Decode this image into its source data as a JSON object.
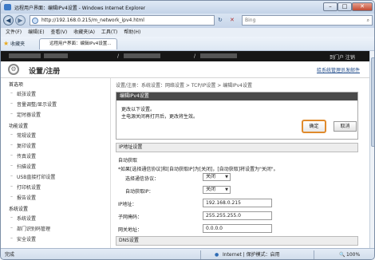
{
  "window": {
    "title": "远程用户界面：编辑IPv4设置 - Windows Internet Explorer"
  },
  "address": {
    "url": "http://192.168.0.215/m_network_ipv4.html",
    "search_placeholder": "Bing",
    "refresh": "↻",
    "stop": "✕"
  },
  "menu": [
    "文件(F)",
    "编辑(E)",
    "查看(V)",
    "收藏夹(A)",
    "工具(T)",
    "帮助(H)"
  ],
  "favorites": {
    "label": "收藏夹",
    "tab": "远程用户界面：编辑IPv4设置..."
  },
  "topbar": {
    "left": "/",
    "right": "到门户  注销"
  },
  "header": {
    "title": "设置/注册",
    "link": "给系统管理员发邮件"
  },
  "sidebar": {
    "groups": [
      {
        "label": "首选项",
        "items": [
          "纸张设置",
          "音量调整/显示设置",
          "定时器设置"
        ]
      },
      {
        "label": "功能设置",
        "items": [
          "常规设置",
          "复印设置",
          "传真设置",
          "扫描设置",
          "USB直接打印设置",
          "打印机设置",
          "报告设置"
        ]
      },
      {
        "label": "系统设置",
        "items": [
          "系统设置",
          "部门识别码管理",
          "安全设置"
        ]
      }
    ]
  },
  "breadcrumb": "设置/注册：系统设置：网络设置 > TCP/IP设置 > 编辑IPv4设置",
  "dialog": {
    "title": "编辑IPv4设置",
    "msg1": "更改以下设置。",
    "msg2": "主电源关闭再打开后，更改将生效。",
    "ok": "确定",
    "cancel": "取消"
  },
  "ipv4": {
    "section": "IP地址设置",
    "auto_get": "自动获取",
    "note": "*如果[选择通信协议]和[自动获取IP]为[关闭]，[自动获取]将设置为\"关闭\"。",
    "protocol_label": "选择通信协议：",
    "protocol_value": "关闭",
    "autoip_label": "自动获取IP：",
    "autoip_value": "关闭",
    "ip_label": "IP地址：",
    "ip_value": "192.168.0.215",
    "mask_label": "子网掩码：",
    "mask_value": "255.255.255.0",
    "gw_label": "网关地址：",
    "gw_value": "0.0.0.0"
  },
  "dns": {
    "section": "DNS设置"
  },
  "status": {
    "left": "完成",
    "zone": "Internet | 保护模式：启用",
    "zoom": "100%"
  }
}
